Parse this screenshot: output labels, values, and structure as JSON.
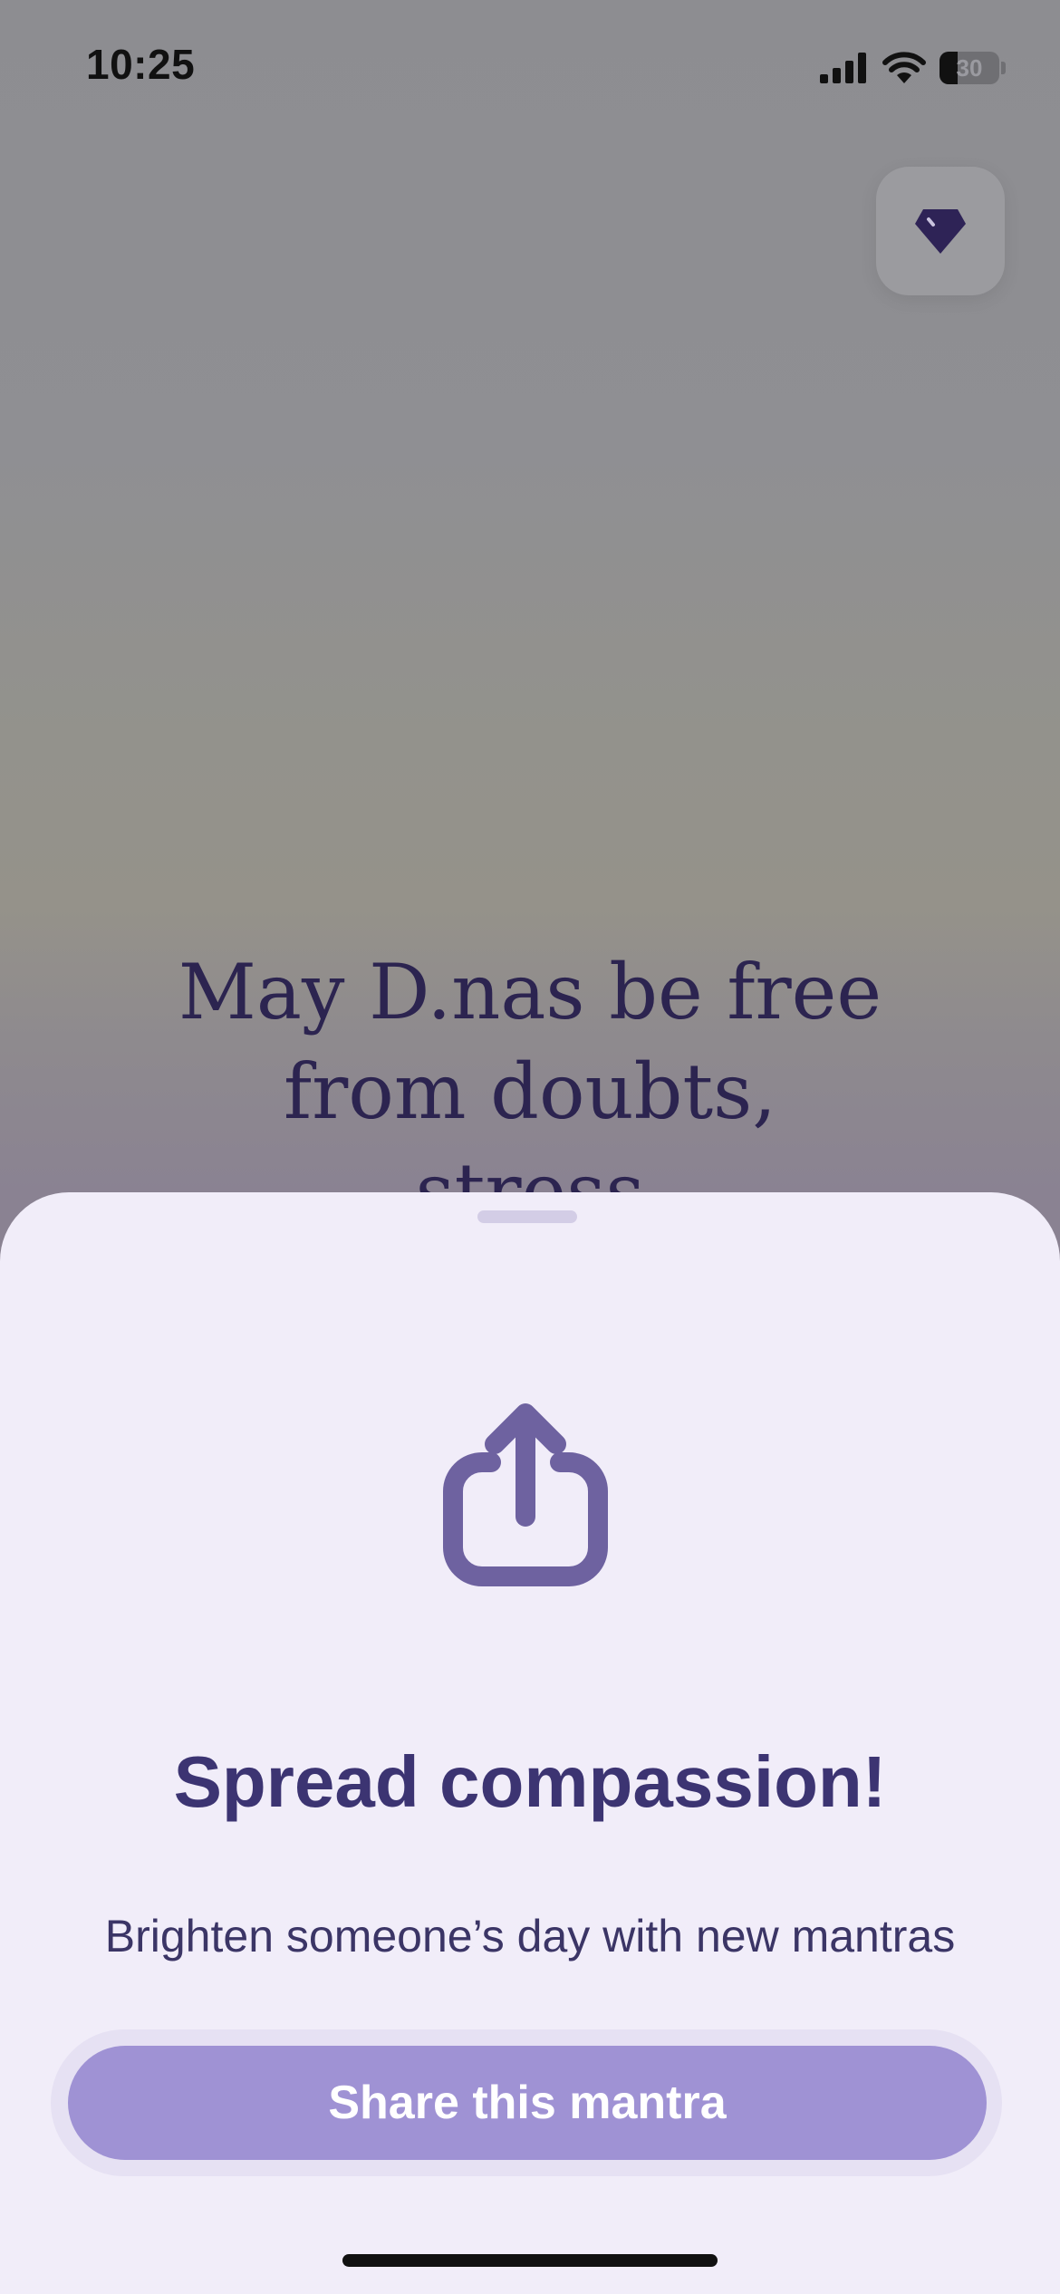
{
  "status_bar": {
    "time": "10:25",
    "battery_level": "30",
    "icons": [
      "signal-icon",
      "wifi-icon",
      "battery-icon"
    ]
  },
  "header": {
    "premium_icon": "gem-icon"
  },
  "mantra": {
    "text": "May D.nas be free\nfrom doubts,\nstress"
  },
  "sheet": {
    "icon": "share-icon",
    "title": "Spread compassion!",
    "subtitle": "Brighten someone’s day with new mantras",
    "share_button_label": "Share this mantra"
  },
  "colors": {
    "sheet_background": "#f1edf9",
    "title": "#3c3472",
    "button": "#9f92d4",
    "icon": "#6e62a0",
    "mantra_text": "#2c2450"
  }
}
